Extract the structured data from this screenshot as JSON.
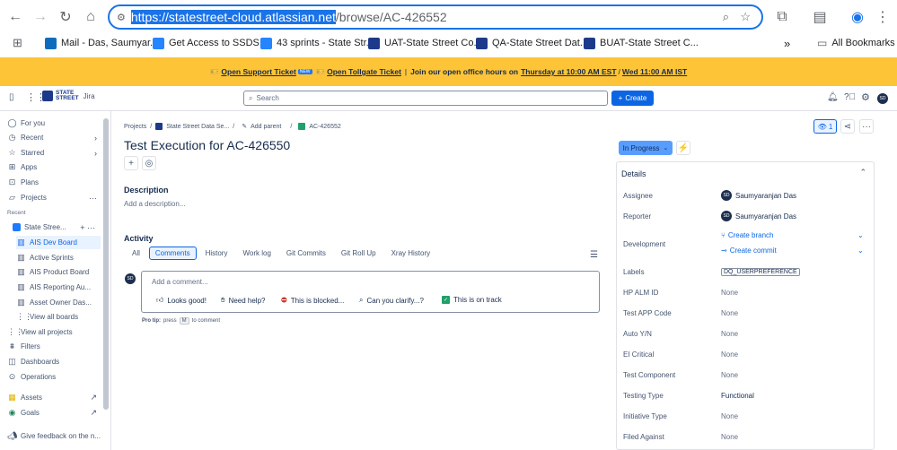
{
  "browser": {
    "url_selected": "https://statestreet-cloud.atlassian.net",
    "url_rest": "/browse/AC-426552",
    "bookmarks": [
      {
        "label": "Mail - Das, Saumyar...",
        "color": "#0f6cbd"
      },
      {
        "label": "Get Access to SSDS...",
        "color": "#2684ff"
      },
      {
        "label": "43 sprints - State Str...",
        "color": "#2684ff"
      },
      {
        "label": "UAT-State Street Co...",
        "color": "#1d3a8a"
      },
      {
        "label": "QA-State Street Dat...",
        "color": "#1d3a8a"
      },
      {
        "label": "BUAT-State Street C...",
        "color": "#1d3a8a"
      }
    ],
    "more_bookmarks": "»",
    "all_bookmarks": "All Bookmarks"
  },
  "banner": {
    "open_support": "Open Support Ticket",
    "new_badge": "NEW",
    "open_tollgate": "Open Tollgate Ticket",
    "sep": "|",
    "join_text": "Join our open office hours on",
    "thursday": "Thursday at 10:00 AM EST",
    "slash": "/",
    "wednesday": "Wed 11:00 AM IST"
  },
  "topbar": {
    "logo_line1": "STATE",
    "logo_line2": "STREET",
    "product": "Jira",
    "search_placeholder": "Search",
    "create": "Create",
    "user_initials": "SD"
  },
  "sidebar": {
    "for_you": "For you",
    "recent": "Recent",
    "starred": "Starred",
    "apps": "Apps",
    "plans": "Plans",
    "projects": "Projects",
    "recent_header": "Recent",
    "project_name": "State Stree...",
    "boards": [
      "AIS Dev Board",
      "Active Sprints",
      "AIS Product Board",
      "AIS Reporting Au...",
      "Asset Owner Das..."
    ],
    "view_all_boards": "View all boards",
    "view_all_projects": "View all projects",
    "filters": "Filters",
    "dashboards": "Dashboards",
    "operations": "Operations",
    "assets": "Assets",
    "goals": "Goals",
    "feedback": "Give feedback on the n..."
  },
  "issue": {
    "crumb_projects": "Projects",
    "crumb_sep": "/",
    "crumb_project": "State Street Data Se...",
    "crumb_add_parent": "Add parent",
    "crumb_key": "AC-426552",
    "title": "Test Execution for AC-426550",
    "description_h": "Description",
    "description_ph": "Add a description...",
    "activity_h": "Activity",
    "tabs": [
      "All",
      "Comments",
      "History",
      "Work log",
      "Git Commits",
      "Git Roll Up",
      "Xray History"
    ],
    "comment_ph": "Add a comment...",
    "quick_replies": [
      "Looks good!",
      "Need help?",
      "This is blocked...",
      "Can you clarify...?",
      "This is on track"
    ],
    "pro_tip_a": "Pro tip:",
    "pro_tip_b": "press",
    "pro_tip_key": "M",
    "pro_tip_c": "to comment"
  },
  "right": {
    "watch_count": "1",
    "status": "In Progress",
    "details_h": "Details",
    "fields": [
      {
        "label": "Assignee",
        "value": "Saumyaranjan Das",
        "kind": "user"
      },
      {
        "label": "Reporter",
        "value": "Saumyaranjan Das",
        "kind": "user"
      },
      {
        "label": "Labels",
        "value": "DQ_USERPREFERENCE",
        "kind": "tag"
      },
      {
        "label": "HP ALM ID",
        "value": "None",
        "kind": "none"
      },
      {
        "label": "Test APP Code",
        "value": "None",
        "kind": "none"
      },
      {
        "label": "Auto Y/N",
        "value": "None",
        "kind": "none"
      },
      {
        "label": "EI Critical",
        "value": "None",
        "kind": "none"
      },
      {
        "label": "Test Component",
        "value": "None",
        "kind": "none"
      },
      {
        "label": "Testing Type",
        "value": "Functional",
        "kind": "text"
      },
      {
        "label": "Initiative Type",
        "value": "None",
        "kind": "none"
      },
      {
        "label": "Filed Against",
        "value": "None",
        "kind": "none"
      }
    ],
    "development_label": "Development",
    "create_branch": "Create branch",
    "create_commit": "Create commit"
  }
}
